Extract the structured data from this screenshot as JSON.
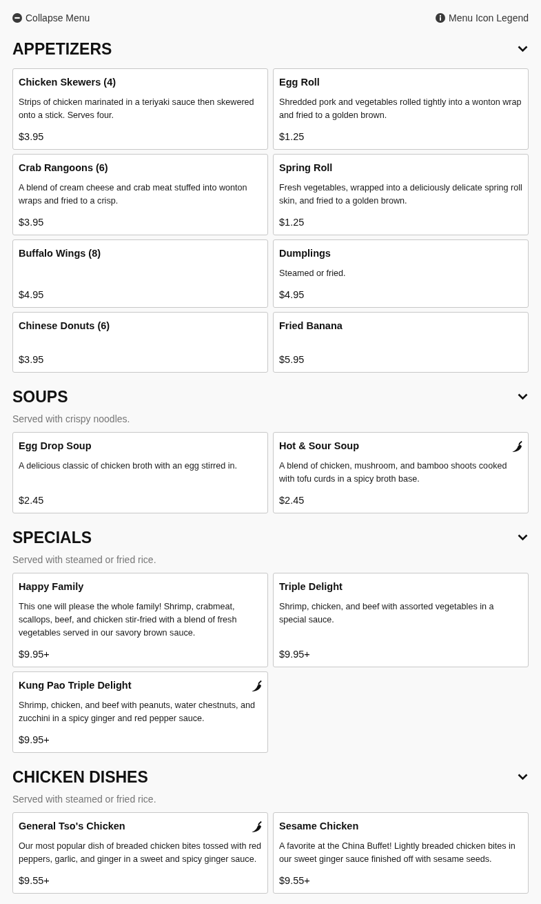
{
  "toolbar": {
    "collapse_label": "Collapse Menu",
    "legend_label": "Menu Icon Legend"
  },
  "sections": [
    {
      "title": "APPETIZERS",
      "expanded": true,
      "items": [
        {
          "name": "Chicken Skewers (4)",
          "description": "Strips of chicken marinated in a teriyaki sauce then skewered onto a stick. Serves four.",
          "price": "$3.95",
          "spicy": false
        },
        {
          "name": "Egg Roll",
          "description": "Shredded pork and vegetables rolled tightly into a wonton wrap and fried to a golden brown.",
          "price": "$1.25",
          "spicy": false
        },
        {
          "name": "Crab Rangoons (6)",
          "description": "A blend of cream cheese and crab meat stuffed into wonton wraps and fried to a crisp.",
          "price": "$3.95",
          "spicy": false
        },
        {
          "name": "Spring Roll",
          "description": "Fresh vegetables, wrapped into a deliciously delicate spring roll skin, and fried to a golden brown.",
          "price": "$1.25",
          "spicy": false
        },
        {
          "name": "Buffalo Wings (8)",
          "price": "$4.95",
          "spicy": false
        },
        {
          "name": "Dumplings",
          "description": "Steamed or fried.",
          "price": "$4.95",
          "spicy": false
        },
        {
          "name": "Chinese Donuts (6)",
          "price": "$3.95",
          "spicy": false
        },
        {
          "name": "Fried Banana",
          "price": "$5.95",
          "spicy": false
        }
      ]
    },
    {
      "title": "SOUPS",
      "note": "Served with crispy noodles.",
      "expanded": true,
      "items": [
        {
          "name": "Egg Drop Soup",
          "description": "A delicious classic of chicken broth with an egg stirred in.",
          "price": "$2.45",
          "spicy": false
        },
        {
          "name": "Hot & Sour Soup",
          "description": "A blend of chicken, mushroom, and bamboo shoots cooked with tofu curds in a spicy broth base.",
          "price": "$2.45",
          "spicy": true
        }
      ]
    },
    {
      "title": "SPECIALS",
      "note": "Served with steamed or fried rice.",
      "expanded": true,
      "items": [
        {
          "name": "Happy Family",
          "description": "This one will please the whole family! Shrimp, crabmeat, scallops, beef, and chicken stir-fried with a blend of fresh vegetables served in our savory brown sauce.",
          "price": "$9.95+",
          "spicy": false
        },
        {
          "name": "Triple Delight",
          "description": "Shrimp, chicken, and beef with assorted vegetables in a special sauce.",
          "price": "$9.95+",
          "spicy": false
        },
        {
          "name": "Kung Pao Triple Delight",
          "description": "Shrimp, chicken, and beef with peanuts, water chestnuts, and zucchini in a spicy ginger and red pepper sauce.",
          "price": "$9.95+",
          "spicy": true
        }
      ]
    },
    {
      "title": "CHICKEN DISHES",
      "note": "Served with steamed or fried rice.",
      "expanded": true,
      "items": [
        {
          "name": "General Tso's Chicken",
          "description": "Our most popular dish of breaded chicken bites tossed with red peppers, garlic, and ginger in a sweet and spicy ginger sauce.",
          "price": "$9.55+",
          "spicy": true
        },
        {
          "name": "Sesame Chicken",
          "description": "A favorite at the China Buffet! Lightly breaded chicken bites in our sweet ginger sauce finished off with sesame seeds.",
          "price": "$9.55+",
          "spicy": false
        }
      ]
    }
  ]
}
